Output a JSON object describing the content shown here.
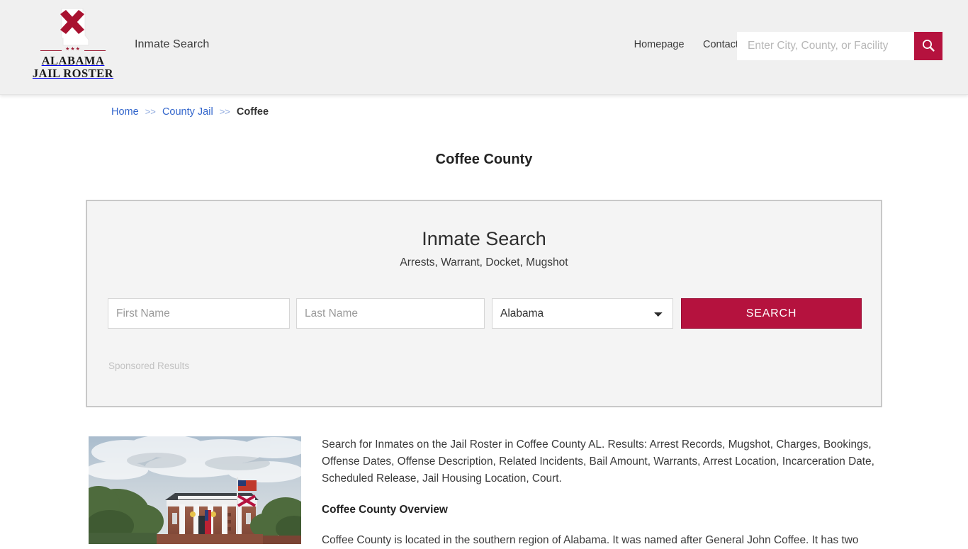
{
  "header": {
    "logo": {
      "line1": "ALABAMA",
      "line2": "JAIL ROSTER",
      "stars": "★★★",
      "mark_icon": "alabama-state-outline-with-red-cross"
    },
    "tagline": "Inmate Search",
    "nav": [
      {
        "label": "Homepage"
      },
      {
        "label": "Contact"
      }
    ],
    "search": {
      "placeholder": "Enter City, County, or Facility",
      "value": "",
      "button_icon": "search-icon"
    },
    "accent_color": "#b5123e",
    "background_color": "#f0f0f0"
  },
  "breadcrumb": {
    "items": [
      {
        "label": "Home",
        "link": true
      },
      {
        "label": "County Jail",
        "link": true
      },
      {
        "label": "Coffee",
        "link": false
      }
    ],
    "separator": ">>",
    "link_color": "#3366cc"
  },
  "page": {
    "title": "Coffee County"
  },
  "widget": {
    "title": "Inmate Search",
    "subtitle": "Arrests, Warrant, Docket, Mugshot",
    "first_name_placeholder": "First Name",
    "first_name_value": "",
    "last_name_placeholder": "Last Name",
    "last_name_value": "",
    "state_selected": "Alabama",
    "state_options": [
      "Alabama"
    ],
    "search_button": "SEARCH",
    "sponsored_label": "Sponsored Results",
    "button_color": "#b5123e",
    "border_color": "#c8c8c8"
  },
  "content": {
    "photo_alt": "coffee-county-courthouse-photo",
    "paragraph1": "Search for Inmates on the Jail Roster in Coffee County AL. Results: Arrest Records, Mugshot, Charges, Bookings, Offense Dates, Offense Description, Related Incidents, Bail Amount, Warrants, Arrest Location, Incarceration Date, Scheduled Release, Jail Housing Location, Court.",
    "overview_heading": "Coffee County Overview",
    "paragraph2": "Coffee County is located in the southern region of Alabama. It was named after General John Coffee. It has two"
  }
}
